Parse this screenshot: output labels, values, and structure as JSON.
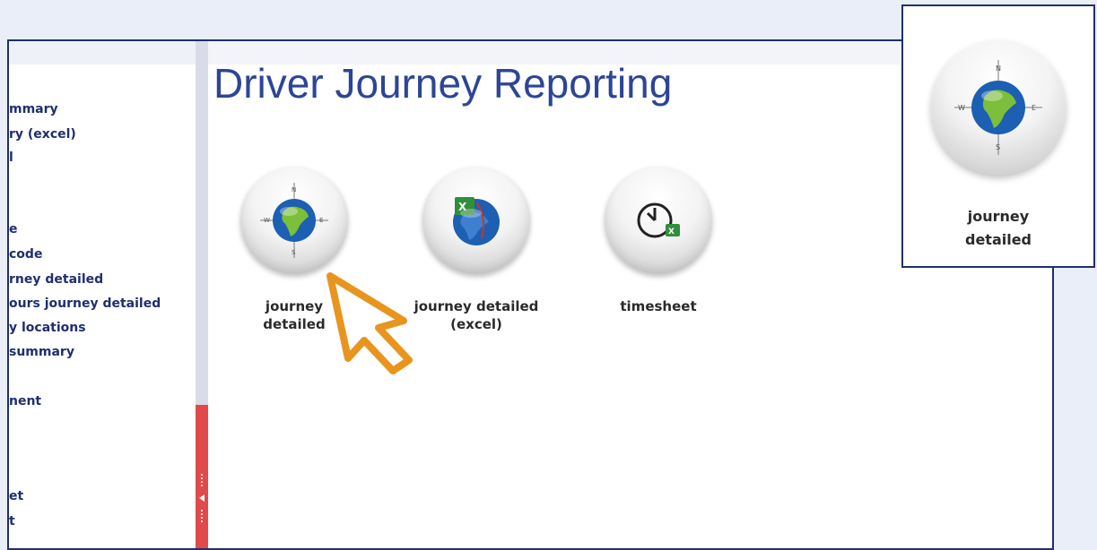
{
  "page": {
    "title": "Driver Journey Reporting"
  },
  "sidebar": {
    "items": [
      "mmary",
      "ry (excel)",
      "l",
      "e",
      "code",
      "rney detailed",
      "ours journey detailed",
      "y locations",
      " summary",
      "nent",
      "et",
      "t"
    ]
  },
  "tiles": [
    {
      "label_line1": "journey",
      "label_line2": "detailed",
      "icon": "globe-compass-icon"
    },
    {
      "label_line1": "journey detailed",
      "label_line2": "(excel)",
      "icon": "globe-excel-icon"
    },
    {
      "label_line1": "timesheet",
      "label_line2": "",
      "icon": "clock-excel-icon"
    }
  ],
  "callout": {
    "label_line1": "journey",
    "label_line2": "detailed",
    "icon": "globe-compass-icon"
  },
  "colors": {
    "accent": "#2d4596",
    "border": "#1f2f6e",
    "splitter_active": "#e04a4a",
    "cursor": "#e8951f"
  }
}
